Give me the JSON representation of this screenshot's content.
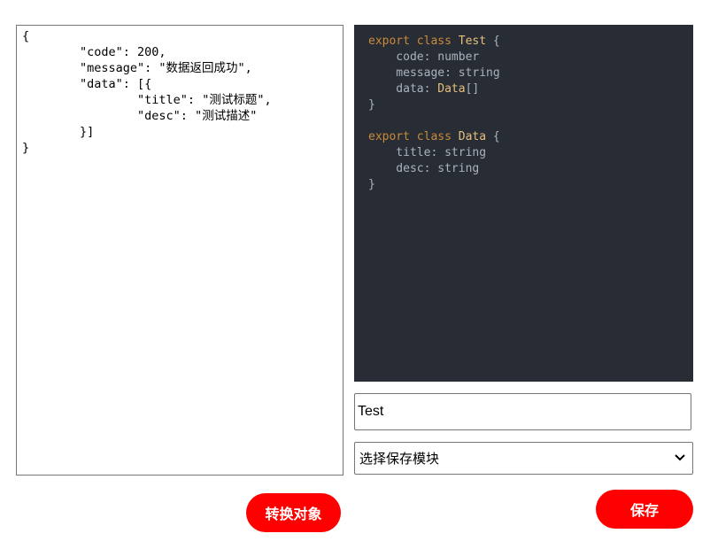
{
  "json_input": {
    "value": "{\n        \"code\": 200,\n        \"message\": \"数据返回成功\",\n        \"data\": [{\n                \"title\": \"测试标题\",\n                \"desc\": \"测试描述\"\n        }]\n}"
  },
  "code_output": {
    "lines": [
      [
        {
          "t": "export class ",
          "c": "kw"
        },
        {
          "t": "Test",
          "c": "cls"
        },
        {
          "t": " {",
          "c": "prop"
        }
      ],
      [
        {
          "t": "    code: ",
          "c": "prop"
        },
        {
          "t": "number",
          "c": "typ"
        }
      ],
      [
        {
          "t": "    message: ",
          "c": "prop"
        },
        {
          "t": "string",
          "c": "typ"
        }
      ],
      [
        {
          "t": "    data: ",
          "c": "prop"
        },
        {
          "t": "Data",
          "c": "cls"
        },
        {
          "t": "[]",
          "c": "prop"
        }
      ],
      [
        {
          "t": "}",
          "c": "prop"
        }
      ],
      [
        {
          "t": "",
          "c": "prop"
        }
      ],
      [
        {
          "t": "export class ",
          "c": "kw"
        },
        {
          "t": "Data",
          "c": "cls"
        },
        {
          "t": " {",
          "c": "prop"
        }
      ],
      [
        {
          "t": "    title: ",
          "c": "prop"
        },
        {
          "t": "string",
          "c": "typ"
        }
      ],
      [
        {
          "t": "    desc: ",
          "c": "prop"
        },
        {
          "t": "string",
          "c": "typ"
        }
      ],
      [
        {
          "t": "}",
          "c": "prop"
        }
      ]
    ]
  },
  "class_name_input": {
    "value": "Test"
  },
  "module_select": {
    "selected": "选择保存模块"
  },
  "buttons": {
    "convert_label": "转换对象",
    "save_label": "保存"
  },
  "colors": {
    "button_bg": "#ff0000",
    "code_bg": "#282c34",
    "keyword": "#c98a3b",
    "class_name": "#e5c07b",
    "code_text": "#abb2bf"
  },
  "icons": {
    "select_arrow": "chevron-down-icon"
  }
}
